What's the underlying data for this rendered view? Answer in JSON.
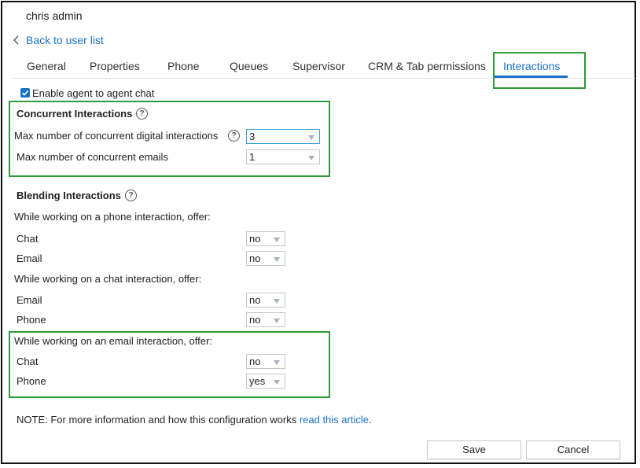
{
  "header": {
    "user_name": "chris admin",
    "back_label": "Back to user list"
  },
  "tabs": [
    {
      "label": "General"
    },
    {
      "label": "Properties"
    },
    {
      "label": "Phone"
    },
    {
      "label": "Queues"
    },
    {
      "label": "Supervisor"
    },
    {
      "label": "CRM & Tab permissions"
    },
    {
      "label": "Interactions",
      "active": true
    }
  ],
  "enable_chat": {
    "label": "Enable agent to agent chat",
    "checked": true
  },
  "concurrent": {
    "title": "Concurrent Interactions",
    "digital_label": "Max number of concurrent digital interactions",
    "digital_value": "3",
    "emails_label": "Max number of concurrent emails",
    "emails_value": "1"
  },
  "blending": {
    "title": "Blending Interactions",
    "phone_heading": "While working on a phone interaction, offer:",
    "phone_chat_label": "Chat",
    "phone_chat_value": "no",
    "phone_email_label": "Email",
    "phone_email_value": "no",
    "chat_heading": "While working on a chat interaction, offer:",
    "chat_email_label": "Email",
    "chat_email_value": "no",
    "chat_phone_label": "Phone",
    "chat_phone_value": "no",
    "email_heading": "While working on an email interaction, offer:",
    "email_chat_label": "Chat",
    "email_chat_value": "no",
    "email_phone_label": "Phone",
    "email_phone_value": "yes"
  },
  "note": {
    "text": "NOTE: For more information and how this configuration works ",
    "link": "read this article",
    "end": "."
  },
  "footer": {
    "save_label": "Save",
    "cancel_label": "Cancel"
  },
  "colors": {
    "accent": "#1a73c9",
    "highlight": "#2e9b3a"
  }
}
